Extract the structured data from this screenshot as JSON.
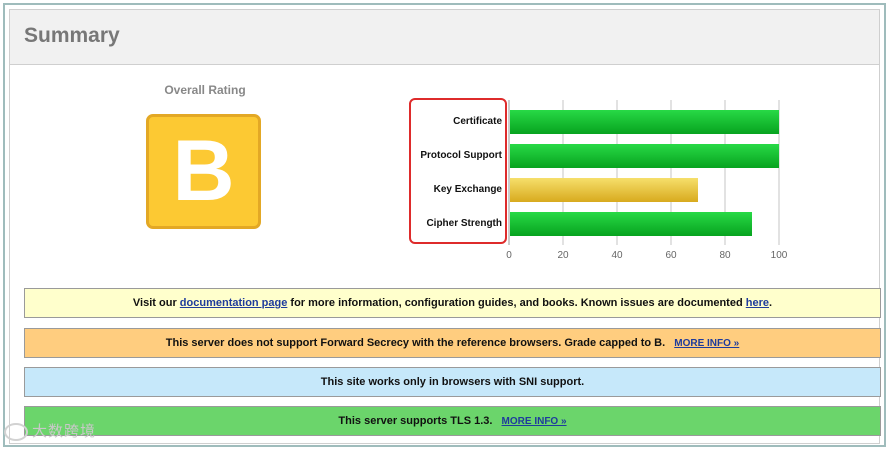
{
  "header": {
    "title": "Summary"
  },
  "overall": {
    "label": "Overall Rating",
    "grade": "B"
  },
  "chart_data": {
    "type": "bar",
    "orientation": "horizontal",
    "categories": [
      "Certificate",
      "Protocol Support",
      "Key Exchange",
      "Cipher Strength"
    ],
    "values": [
      100,
      100,
      70,
      90
    ],
    "bar_colors": [
      "#0fbf2f",
      "#0fbf2f",
      "#e8c33a",
      "#0fbf2f"
    ],
    "xlim": [
      0,
      100
    ],
    "xticks": [
      0,
      20,
      40,
      60,
      80,
      100
    ],
    "grid": true
  },
  "notices": {
    "documentation": {
      "prefix": "Visit our ",
      "link": "documentation page",
      "middle": " for more information, configuration guides, and books. Known issues are documented ",
      "link2": "here",
      "suffix": "."
    },
    "forward_secrecy": {
      "text": "This server does not support Forward Secrecy with the reference browsers. Grade capped to B.",
      "link": "MORE INFO »"
    },
    "sni": {
      "text": "This site works only in browsers with SNI support."
    },
    "tls13": {
      "text": "This server supports TLS 1.3.",
      "link": "MORE INFO »"
    }
  },
  "watermark": {
    "text": "大数跨境"
  },
  "colors": {
    "grade_fill": "#fcc933",
    "highlight": "#de2b2b",
    "notice_yellow": "#ffffcc",
    "notice_orange": "#ffcd7f",
    "notice_blue": "#c6e8fa",
    "notice_green": "#6bd56b"
  }
}
